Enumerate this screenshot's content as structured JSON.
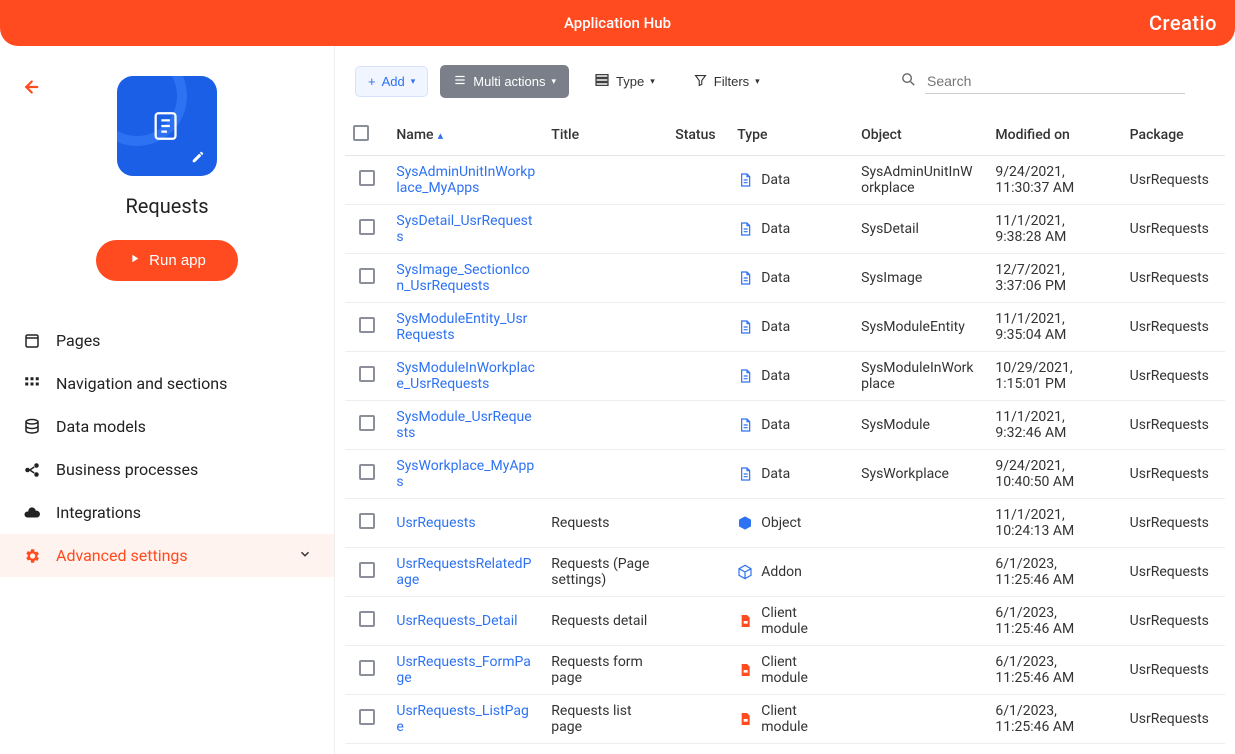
{
  "header": {
    "title": "Application Hub",
    "brand": "Creatio"
  },
  "sidebar": {
    "app_name": "Requests",
    "run_label": "Run app",
    "items": [
      {
        "label": "Pages",
        "icon": "page"
      },
      {
        "label": "Navigation and sections",
        "icon": "grid"
      },
      {
        "label": "Data models",
        "icon": "db"
      },
      {
        "label": "Business processes",
        "icon": "process"
      },
      {
        "label": "Integrations",
        "icon": "cloud"
      },
      {
        "label": "Advanced settings",
        "icon": "gear",
        "active": true
      }
    ]
  },
  "toolbar": {
    "add": "Add",
    "multi": "Multi actions",
    "type": "Type",
    "filters": "Filters",
    "search_placeholder": "Search"
  },
  "columns": {
    "name": "Name",
    "title": "Title",
    "status": "Status",
    "type": "Type",
    "object": "Object",
    "modified": "Modified on",
    "package": "Package"
  },
  "rows": [
    {
      "name": "SysAdminUnitInWorkplace_MyApps",
      "title": "",
      "type": "Data",
      "type_icon": "doc-blue",
      "object": "SysAdminUnitInWorkplace",
      "modified": "9/24/2021, 11:30:37 AM",
      "package": "UsrRequests"
    },
    {
      "name": "SysDetail_UsrRequests",
      "title": "",
      "type": "Data",
      "type_icon": "doc-blue",
      "object": "SysDetail",
      "modified": "11/1/2021, 9:38:28 AM",
      "package": "UsrRequests"
    },
    {
      "name": "SysImage_SectionIcon_UsrRequests",
      "title": "",
      "type": "Data",
      "type_icon": "doc-blue",
      "object": "SysImage",
      "modified": "12/7/2021, 3:37:06 PM",
      "package": "UsrRequests"
    },
    {
      "name": "SysModuleEntity_UsrRequests",
      "title": "",
      "type": "Data",
      "type_icon": "doc-blue",
      "object": "SysModuleEntity",
      "modified": "11/1/2021, 9:35:04 AM",
      "package": "UsrRequests"
    },
    {
      "name": "SysModuleInWorkplace_UsrRequests",
      "title": "",
      "type": "Data",
      "type_icon": "doc-blue",
      "object": "SysModuleInWorkplace",
      "modified": "10/29/2021, 1:15:01 PM",
      "package": "UsrRequests"
    },
    {
      "name": "SysModule_UsrRequests",
      "title": "",
      "type": "Data",
      "type_icon": "doc-blue",
      "object": "SysModule",
      "modified": "11/1/2021, 9:32:46 AM",
      "package": "UsrRequests"
    },
    {
      "name": "SysWorkplace_MyApps",
      "title": "",
      "type": "Data",
      "type_icon": "doc-blue",
      "object": "SysWorkplace",
      "modified": "9/24/2021, 10:40:50 AM",
      "package": "UsrRequests"
    },
    {
      "name": "UsrRequests",
      "title": "Requests",
      "type": "Object",
      "type_icon": "cube-blue",
      "object": "",
      "modified": "11/1/2021, 10:24:13 AM",
      "package": "UsrRequests"
    },
    {
      "name": "UsrRequestsRelatedPage",
      "title": "Requests (Page settings)",
      "type": "Addon",
      "type_icon": "cube-outline-blue",
      "object": "",
      "modified": "6/1/2023, 11:25:46 AM",
      "package": "UsrRequests"
    },
    {
      "name": "UsrRequests_Detail",
      "title": "Requests detail",
      "type": "Client module",
      "type_icon": "doc-red",
      "object": "",
      "modified": "6/1/2023, 11:25:46 AM",
      "package": "UsrRequests"
    },
    {
      "name": "UsrRequests_FormPage",
      "title": "Requests form page",
      "type": "Client module",
      "type_icon": "doc-red",
      "object": "",
      "modified": "6/1/2023, 11:25:46 AM",
      "package": "UsrRequests"
    },
    {
      "name": "UsrRequests_ListPage",
      "title": "Requests list page",
      "type": "Client module",
      "type_icon": "doc-red",
      "object": "",
      "modified": "6/1/2023, 11:25:46 AM",
      "package": "UsrRequests"
    }
  ]
}
